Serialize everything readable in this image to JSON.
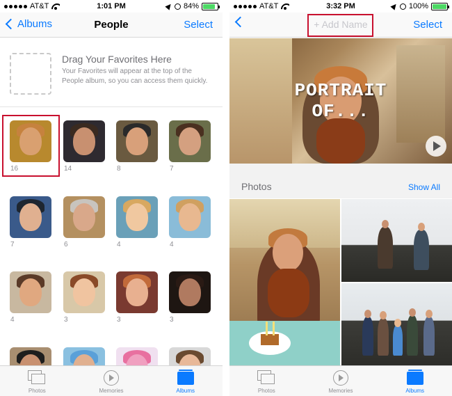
{
  "left": {
    "status": {
      "carrier": "AT&T",
      "time": "1:01 PM",
      "battery": "84%",
      "battery_level": 0.84
    },
    "nav": {
      "back_label": "Albums",
      "title": "People",
      "select_label": "Select"
    },
    "favorites": {
      "title": "Drag Your Favorites Here",
      "subtitle": "Your Favorites will appear at the top of the People album, so you can access them quickly."
    },
    "people": [
      {
        "count": "16",
        "skin": "#d9a070",
        "hair": "#c6823e",
        "bg": "#b8892e"
      },
      {
        "count": "14",
        "skin": "#c89070",
        "hair": "#3a2a20",
        "bg": "#2e2a30"
      },
      {
        "count": "8",
        "skin": "#d8a07a",
        "hair": "#2a2a2a",
        "bg": "#6a5a40"
      },
      {
        "count": "7",
        "skin": "#d4a080",
        "hair": "#4a3020",
        "bg": "#6a6e4a"
      },
      {
        "count": "7",
        "skin": "#e0b090",
        "hair": "#1e2630",
        "bg": "#3a5a8a"
      },
      {
        "count": "6",
        "skin": "#d9a88a",
        "hair": "#c8c4be",
        "bg": "#b49060"
      },
      {
        "count": "4",
        "skin": "#f0c8a0",
        "hair": "#d8a860",
        "bg": "#6aa0b8"
      },
      {
        "count": "4",
        "skin": "#e8b890",
        "hair": "#d0a060",
        "bg": "#8abcd8"
      },
      {
        "count": "4",
        "skin": "#e0a880",
        "hair": "#5a3a28",
        "bg": "#c8b8a0"
      },
      {
        "count": "3",
        "skin": "#f0c4a0",
        "hair": "#8a4a28",
        "bg": "#d8c8a8"
      },
      {
        "count": "3",
        "skin": "#e8b090",
        "hair": "#c26a3a",
        "bg": "#7a3a30"
      },
      {
        "count": "3",
        "skin": "#b07a60",
        "hair": "#2a1a14",
        "bg": "#1e1612"
      },
      {
        "count": "",
        "skin": "#c89070",
        "hair": "#1e1e1e",
        "bg": "#a88e70"
      },
      {
        "count": "",
        "skin": "#e0b090",
        "hair": "#5aa0d8",
        "bg": "#8ac0e0"
      },
      {
        "count": "",
        "skin": "#f0a0c0",
        "hair": "#e870a0",
        "bg": "#f0e0f0"
      },
      {
        "count": "",
        "skin": "#e8b898",
        "hair": "#6a4a30",
        "bg": "#d8d8d8"
      }
    ],
    "tabs": [
      {
        "label": "Photos",
        "icon": "photos-icon",
        "active": false
      },
      {
        "label": "Memories",
        "icon": "memories-icon",
        "active": false
      },
      {
        "label": "Albums",
        "icon": "albums-icon",
        "active": true
      }
    ]
  },
  "right": {
    "status": {
      "carrier": "AT&T",
      "time": "3:32 PM",
      "battery": "100%",
      "battery_level": 1.0
    },
    "nav": {
      "add_name_label": "+ Add Name",
      "select_label": "Select"
    },
    "hero": {
      "title_line1": "PORTRAIT",
      "title_line2": "OF..."
    },
    "section": {
      "title": "Photos",
      "show_all_label": "Show All"
    },
    "tabs": [
      {
        "label": "Photos",
        "icon": "photos-icon",
        "active": false
      },
      {
        "label": "Memories",
        "icon": "memories-icon",
        "active": false
      },
      {
        "label": "Albums",
        "icon": "albums-icon",
        "active": true
      }
    ]
  },
  "colors": {
    "accent": "#0a7aff",
    "highlight": "#c8102e",
    "battery_fill": "#4cd964"
  }
}
